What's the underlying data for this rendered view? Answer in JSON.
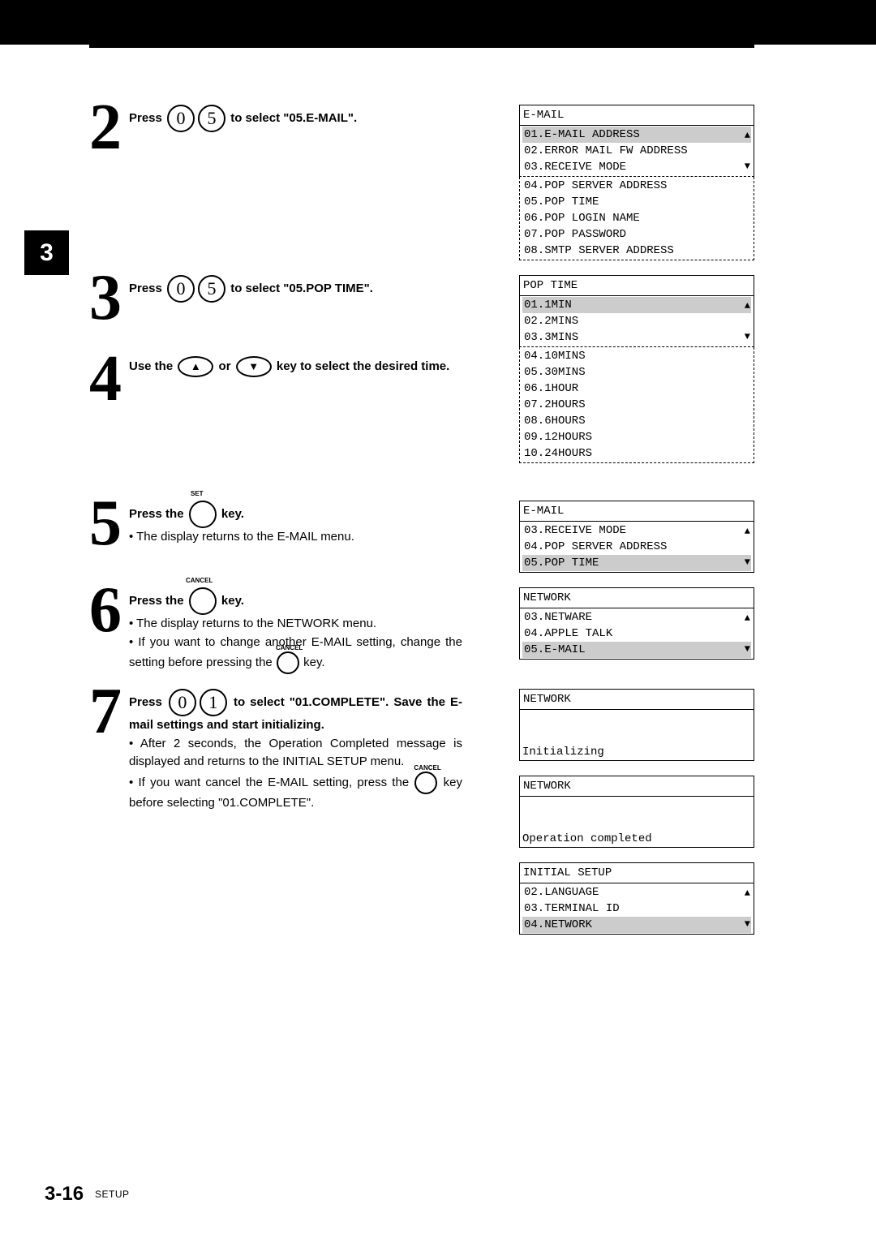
{
  "tab": "3",
  "steps": {
    "s2": {
      "num": "2",
      "text_a": "Press ",
      "key1": "0",
      "key2": "5",
      "text_b": " to select \"05.E-MAIL\"."
    },
    "s3": {
      "num": "3",
      "text_a": "Press ",
      "key1": "0",
      "key2": "5",
      "text_b": " to select \"05.POP TIME\"."
    },
    "s4": {
      "num": "4",
      "text_a": "Use the ",
      "up": "▲",
      "down": "▼",
      "or": " or ",
      "text_b": " key to select the desired time."
    },
    "s5": {
      "num": "5",
      "label": "SET",
      "text_a": "Press the ",
      "key": "",
      "text_b": " key.",
      "bullet1": "• The display returns to the E-MAIL menu."
    },
    "s6": {
      "num": "6",
      "label": "CANCEL",
      "text_a": "Press the ",
      "key": "",
      "text_b": " key.",
      "bullet1": "• The display returns to the NETWORK menu.",
      "bullet2a": "• If you want to change another E-MAIL setting, change the setting before pressing the ",
      "b2label": "CANCEL",
      "bullet2b": " key."
    },
    "s7": {
      "num": "7",
      "text_a": "Press ",
      "key1": "0",
      "key2": "1",
      "text_b": " to select \"01.COMPLETE\". Save the E-mail settings and start initializing.",
      "bullet1": "• After 2 seconds, the Operation Completed message is displayed and returns to the INITIAL SETUP menu.",
      "bullet2a": "• If you want cancel the E-MAIL setting, press the ",
      "b2label": "CANCEL",
      "bullet2b": " key before selecting \"01.COMPLETE\"."
    }
  },
  "displays": {
    "d1": {
      "title": "E-MAIL",
      "items": [
        "01.E-MAIL ADDRESS",
        "02.ERROR MAIL FW ADDRESS",
        "03.RECEIVE MODE"
      ],
      "hl": "01.E-MAIL ADDRESS",
      "extra": [
        "04.POP SERVER ADDRESS",
        "05.POP TIME",
        "06.POP LOGIN NAME",
        "07.POP PASSWORD",
        "08.SMTP SERVER ADDRESS"
      ]
    },
    "d2": {
      "title": "POP TIME",
      "items": [
        "01.1MIN",
        "02.2MINS",
        "03.3MINS"
      ],
      "hl": "01.1MIN",
      "extra": [
        "04.10MINS",
        "05.30MINS",
        "06.1HOUR",
        "07.2HOURS",
        "08.6HOURS",
        "09.12HOURS",
        "10.24HOURS"
      ]
    },
    "d3": {
      "title": "E-MAIL",
      "items": [
        "03.RECEIVE MODE",
        "04.POP SERVER ADDRESS",
        "05.POP TIME"
      ],
      "hl": "05.POP TIME"
    },
    "d4": {
      "title": "NETWORK",
      "items": [
        "03.NETWARE",
        "04.APPLE TALK",
        "05.E-MAIL"
      ],
      "hl": "05.E-MAIL"
    },
    "d5": {
      "title": "NETWORK",
      "msg": "Initializing"
    },
    "d6": {
      "title": "NETWORK",
      "msg": "Operation completed"
    },
    "d7": {
      "title": "INITIAL SETUP",
      "items": [
        "02.LANGUAGE",
        "03.TERMINAL ID",
        "04.NETWORK"
      ],
      "hl": "04.NETWORK"
    }
  },
  "footer": {
    "page": "3-16",
    "section": "SETUP"
  }
}
